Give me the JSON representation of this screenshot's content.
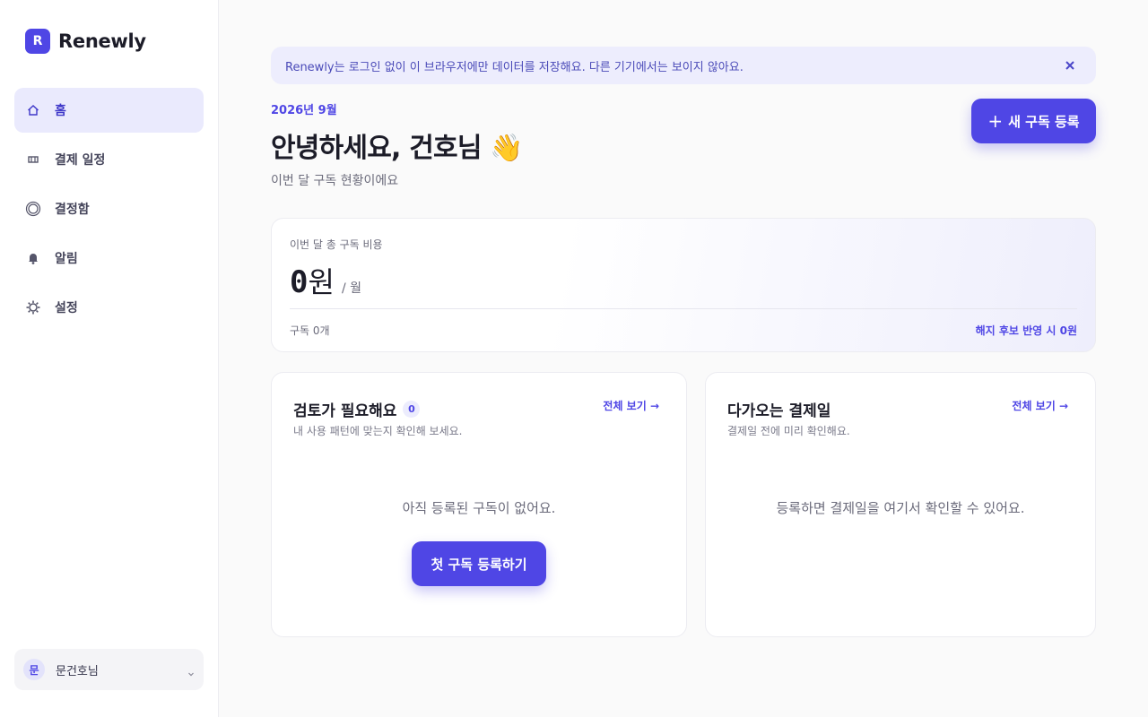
{
  "brand": {
    "logo_letter": "R",
    "name": "Renewly"
  },
  "sidebar": {
    "items": [
      {
        "label": "홈",
        "icon": "home-icon",
        "active": true
      },
      {
        "label": "결제 일정",
        "icon": "calendar-icon",
        "active": false
      },
      {
        "label": "결정함",
        "icon": "target-icon",
        "active": false
      },
      {
        "label": "알림",
        "icon": "bell-icon",
        "active": false
      },
      {
        "label": "설정",
        "icon": "gear-icon",
        "active": false
      }
    ]
  },
  "user": {
    "avatar_letter": "문",
    "name": "문건호님"
  },
  "notice": {
    "text": "Renewly는 로그인 없이 이 브라우저에만 데이터를 저장해요. 다른 기기에서는 보이지 않아요."
  },
  "header": {
    "month": "2026년 9월",
    "greeting": "안녕하세요, 건호님 👋",
    "subtitle": "이번 달 구독 현황이에요",
    "new_button": "새 구독 등록"
  },
  "summary": {
    "label": "이번 달 총 구독 비용",
    "amount": "0",
    "currency": "원",
    "period": "/ 월",
    "count": "구독 0개",
    "cancel_note": "해지 후보 반영 시 0원"
  },
  "review_panel": {
    "title": "검토가 필요해요",
    "count": "0",
    "description": "내 사용 패턴에 맞는지 확인해 보세요.",
    "link": "전체 보기 →",
    "empty": "아직 등록된 구독이 없어요.",
    "cta": "첫 구독 등록하기"
  },
  "upcoming_panel": {
    "title": "다가오는 결제일",
    "description": "결제일 전에 미리 확인해요.",
    "link": "전체 보기 →",
    "empty": "등록하면 결제일을 여기서 확인할 수 있어요."
  },
  "colors": {
    "accent": "#4f46e5",
    "active_nav_bg": "#eaeafd",
    "notice_bg": "#ededfd"
  }
}
